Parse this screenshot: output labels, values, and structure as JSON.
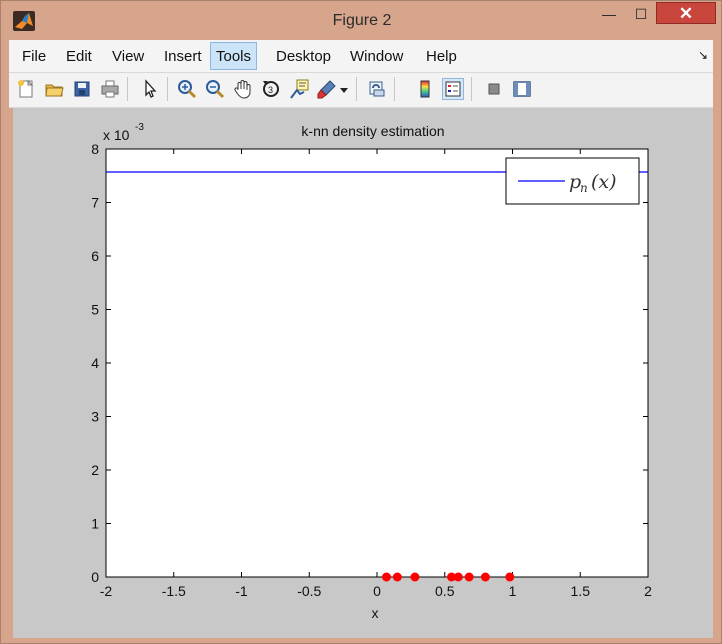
{
  "window": {
    "title": "Figure 2",
    "min_glyph": "—",
    "max_glyph": "☐",
    "close_glyph": "✕",
    "accent": "#d7a58c",
    "close_color": "#c9463d"
  },
  "menu": {
    "items": [
      "File",
      "Edit",
      "View",
      "Insert",
      "Tools",
      "Desktop",
      "Window",
      "Help"
    ],
    "active": "Tools",
    "dock_arrow": "↘"
  },
  "toolbar": {
    "icons": [
      "new-figure-icon",
      "open-file-icon",
      "save-icon",
      "print-icon",
      "pointer-icon",
      "zoom-in-icon",
      "zoom-out-icon",
      "pan-icon",
      "rotate-3d-icon",
      "data-cursor-icon",
      "brush-icon",
      "dropdown-arrow-icon",
      "link-plot-icon",
      "colorbar-icon",
      "legend-icon",
      "hide-plot-tools-icon",
      "show-plot-tools-icon"
    ],
    "active": "legend-icon"
  },
  "chart_data": {
    "type": "line",
    "title": "k-nn density estimation",
    "xlabel": "x",
    "ylabel": "",
    "xlim": [
      -2,
      2
    ],
    "ylim": [
      0,
      0.008
    ],
    "y_exponent_label": "x 10",
    "y_exponent": "-3",
    "x_ticks": [
      "-2",
      "-1.5",
      "-1",
      "-0.5",
      "0",
      "0.5",
      "1",
      "1.5",
      "2"
    ],
    "y_ticks": [
      "0",
      "1",
      "2",
      "3",
      "4",
      "5",
      "6",
      "7",
      "8"
    ],
    "series": [
      {
        "name": "p_n(x)",
        "color": "#0000ff",
        "x": [
          -2,
          2
        ],
        "y": [
          0.00757,
          0.00757
        ]
      }
    ],
    "samples": {
      "color": "#ff0000",
      "x": [
        0.07,
        0.15,
        0.28,
        0.55,
        0.6,
        0.68,
        0.8,
        0.98
      ],
      "y": [
        0,
        0,
        0,
        0,
        0,
        0,
        0,
        0
      ]
    },
    "legend": {
      "position": "top-right",
      "entries": [
        "p",
        "n",
        "(x)"
      ]
    },
    "grid": false
  }
}
